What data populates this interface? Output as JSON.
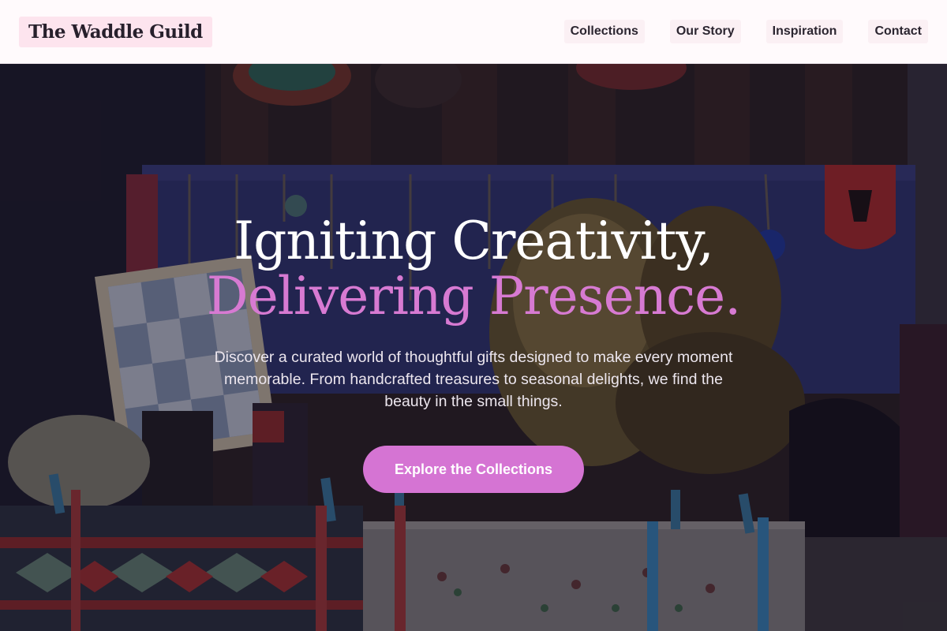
{
  "header": {
    "logo": "The Waddle Guild",
    "nav": [
      {
        "label": "Collections"
      },
      {
        "label": "Our Story"
      },
      {
        "label": "Inspiration"
      },
      {
        "label": "Contact"
      }
    ]
  },
  "hero": {
    "title_line1": "Igniting Creativity,",
    "title_line2": "Delivering Presence.",
    "subtitle": "Discover a curated world of thoughtful gifts designed to make every moment memorable. From handcrafted treasures to seasonal delights, we find the beauty in the small things.",
    "cta_label": "Explore the Collections"
  },
  "colors": {
    "accent": "#d574d3",
    "header_bg": "#fffafc",
    "logo_bg": "#fde4ee",
    "nav_bg": "#fbf0f4"
  }
}
